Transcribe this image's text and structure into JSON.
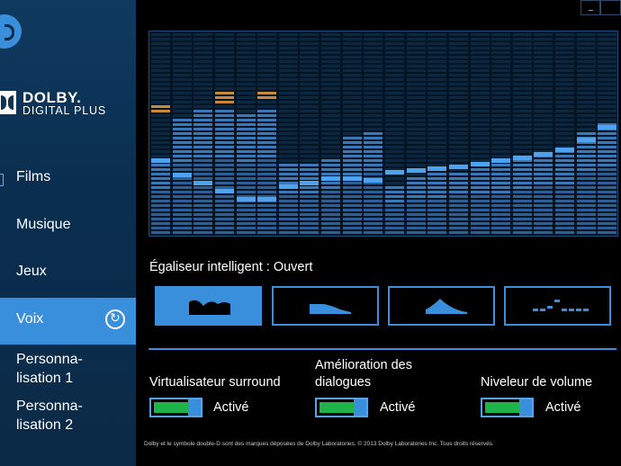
{
  "brand": {
    "line1": "DOLBY.",
    "line2": "DIGITAL PLUS"
  },
  "nav": [
    {
      "label": "Films",
      "icon": "film-icon"
    },
    {
      "label": "Musique"
    },
    {
      "label": "Jeux"
    },
    {
      "label": "Voix",
      "active": true
    },
    {
      "label": "Personna-\nlisation 1"
    },
    {
      "label": "Personna-\nlisation 2"
    }
  ],
  "equalizer": {
    "title": "Égaliseur intelligent : Ouvert",
    "band_levels": [
      0.38,
      0.58,
      0.62,
      0.62,
      0.6,
      0.62,
      0.35,
      0.35,
      0.38,
      0.48,
      0.5,
      0.25,
      0.28,
      0.3,
      0.32,
      0.34,
      0.35,
      0.38,
      0.4,
      0.42,
      0.5,
      0.55
    ],
    "peak_levels": [
      0.65,
      0.0,
      0.0,
      0.7,
      0.0,
      0.72,
      0.0,
      0.0,
      0.0,
      0.0,
      0.0,
      0.0,
      0.0,
      0.0,
      0.0,
      0.0,
      0.0,
      0.0,
      0.0,
      0.0,
      0.0,
      0.0
    ],
    "marker_levels": [
      0.38,
      0.31,
      0.27,
      0.23,
      0.19,
      0.19,
      0.25,
      0.27,
      0.29,
      0.29,
      0.28,
      0.32,
      0.33,
      0.34,
      0.35,
      0.36,
      0.38,
      0.39,
      0.41,
      0.43,
      0.48,
      0.54
    ],
    "presets": [
      {
        "name": "preset-open",
        "selected": true
      },
      {
        "name": "preset-rich"
      },
      {
        "name": "preset-focused"
      },
      {
        "name": "preset-manual"
      }
    ]
  },
  "toggles": [
    {
      "label": "Virtualisateur surround",
      "state": "Activé"
    },
    {
      "label": "Amélioration des\ndialogues",
      "state": "Activé"
    },
    {
      "label": "Niveleur de volume",
      "state": "Activé"
    }
  ],
  "footer": "Dolby et le symbole double-D sont des marques déposées de Dolby Laboratories. © 2013 Dolby Laboratories Inc. Tous droits réservés.",
  "colors": {
    "accent": "#3a8fdc",
    "sidebar": "#0b2a47",
    "toggle_on": "#1fb34a",
    "peak": "#c88a3a"
  }
}
